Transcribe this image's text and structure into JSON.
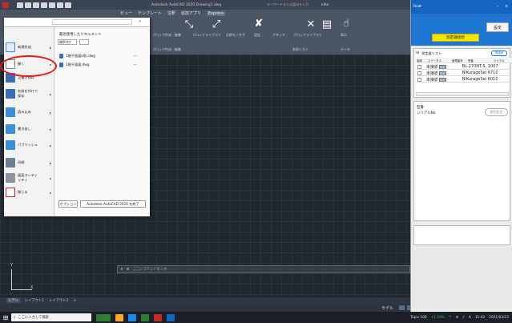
{
  "acad": {
    "window_title": "Autodesk AutoCAD 2020   Drawing1.dwg",
    "search_placeholder": "キーワードまたは語句を入力",
    "user": "kiho",
    "tabs": [
      "ビュー",
      "テンプレート",
      "注釈",
      "追加アプリ",
      "Express"
    ],
    "ribbon_labels": [
      "ブロック作成・編集",
      "ブロックライブラリ",
      "注釈モノタグ",
      "設定",
      "ブロックライブラリ",
      "アタッチ",
      "表示"
    ],
    "ribbon_group_labels": [
      "ブロック作成・編集",
      "参照リスト",
      "データ"
    ]
  },
  "appmenu": {
    "search_placeholder": "",
    "items": [
      {
        "label": "新規作成",
        "icon": "new-file-icon"
      },
      {
        "label": "開く",
        "icon": "open-folder-icon"
      },
      {
        "label": "上書き保存",
        "icon": "save-icon"
      },
      {
        "label": "名前を付けて保存",
        "icon": "save-as-icon"
      },
      {
        "label": "読み込み",
        "icon": "import-icon"
      },
      {
        "label": "書き出し",
        "icon": "export-icon"
      },
      {
        "label": "パブリッシュ",
        "icon": "publish-icon"
      },
      {
        "label": "印刷",
        "icon": "print-icon"
      },
      {
        "label": "図面ユーティリティ",
        "icon": "utilities-icon"
      },
      {
        "label": "閉じる",
        "icon": "close-file-icon"
      }
    ],
    "recent_title": "最近使用したドキュメント",
    "sort_label": "順序付け",
    "recent_files": [
      "1階平面図(改).dwg",
      "1階平面図.dwg"
    ],
    "options_label": "オプション",
    "exit_label": "Autodesk AutoCAD 2020 を終了"
  },
  "cmdline": {
    "placeholder": "ここにコマンドを入力"
  },
  "layout_tabs": [
    "モデル",
    "レイアウト1",
    "レイアウト2",
    "+"
  ],
  "statusbar": {
    "model_label": "モデル"
  },
  "taskbar": {
    "search_placeholder": "ここに入力して検索",
    "weather": "Topix 100",
    "change": "+1.04%",
    "time": "11:42",
    "date": "2021/03/23"
  },
  "rpanel": {
    "title": "Rcat",
    "settings_label": "設定",
    "measure_button": "測定器接続",
    "list_title": "測定器リスト",
    "list_button": "再接続",
    "columns": [
      "接続",
      "ステータス",
      "管理番号",
      "型番",
      "シリアル"
    ],
    "rows": [
      {
        "status": "未接続",
        "badge": "接続",
        "model": "BL-270NT-S",
        "serial": "1007"
      },
      {
        "status": "未接続",
        "badge": "接続",
        "model": "NiKuragoSeries",
        "serial": "6710"
      },
      {
        "status": "未接続",
        "badge": "接続",
        "model": "NiKuragoSeries",
        "serial": "6010"
      }
    ],
    "detail_label1": "型番",
    "detail_label2": "シリアルNo.",
    "detail_button": "個別設定"
  }
}
